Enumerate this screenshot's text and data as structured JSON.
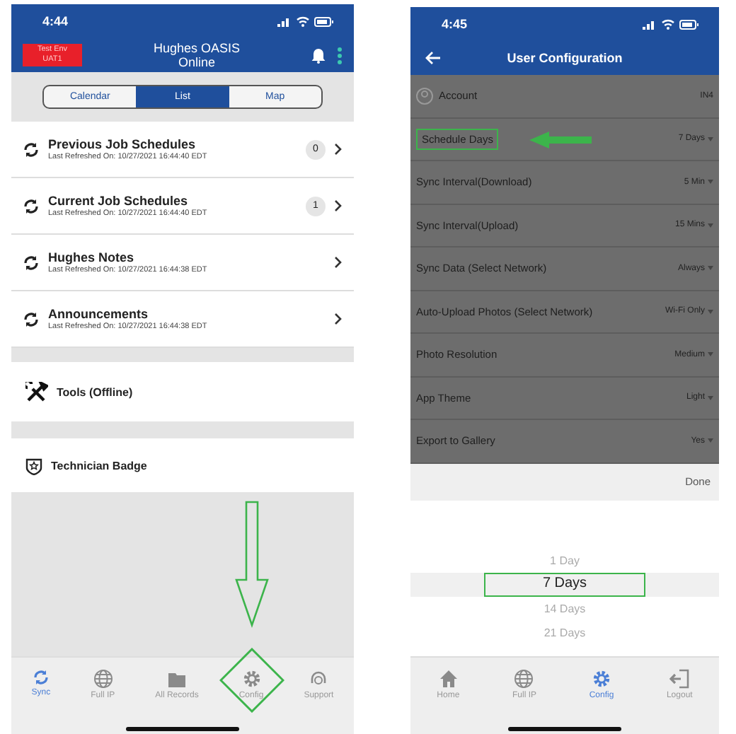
{
  "left_screen": {
    "status_bar": {
      "time": "4:44"
    },
    "header": {
      "env_badge": "Test Env UAT1",
      "title": "Hughes OASIS",
      "subtitle": "Online"
    },
    "segments": [
      {
        "label": "Calendar",
        "selected": false
      },
      {
        "label": "List",
        "selected": true
      },
      {
        "label": "Map",
        "selected": false
      }
    ],
    "sync_rows": [
      {
        "title": "Previous Job Schedules",
        "subtitle": "Last Refreshed On: 10/27/2021 16:44:40 EDT",
        "count": "0"
      },
      {
        "title": "Current Job Schedules",
        "subtitle": "Last Refreshed On: 10/27/2021 16:44:40 EDT",
        "count": "1"
      },
      {
        "title": "Hughes Notes",
        "subtitle": "Last Refreshed On: 10/27/2021 16:44:38 EDT"
      },
      {
        "title": "Announcements",
        "subtitle": "Last Refreshed On: 10/27/2021 16:44:38 EDT"
      }
    ],
    "tool_rows": [
      {
        "kind": "tools",
        "label": "Tools (Offline)"
      },
      {
        "kind": "badge",
        "label": "Technician Badge"
      }
    ],
    "callouts": [
      {
        "kind": "down-arrow"
      }
    ],
    "tab_bar": [
      {
        "kind": "sync",
        "label": "Sync",
        "selected": true,
        "highlighted": false
      },
      {
        "kind": "globe",
        "label": "Full IP",
        "selected": false,
        "highlighted": false
      },
      {
        "kind": "folder",
        "label": "All Records",
        "selected": false,
        "highlighted": false
      },
      {
        "kind": "gear",
        "label": "Config",
        "selected": false,
        "highlighted": true
      },
      {
        "kind": "support",
        "label": "Support",
        "selected": false,
        "highlighted": false
      }
    ]
  },
  "right_screen": {
    "status_bar": {
      "time": "4:45"
    },
    "header": {
      "title": "User Configuration"
    },
    "settings": [
      {
        "kind": "account",
        "label": "Account",
        "value": "IN4",
        "highlighted": false
      },
      {
        "kind": "dropdown",
        "label": "Schedule Days",
        "value": "7 Days",
        "highlighted": true
      },
      {
        "kind": "dropdown",
        "label": "Sync Interval(Download)",
        "value": "5 Min",
        "highlighted": false
      },
      {
        "kind": "dropdown",
        "label": "Sync Interval(Upload)",
        "value": "15 Mins",
        "highlighted": false
      },
      {
        "kind": "dropdown",
        "label": "Sync Data (Select Network)",
        "value": "Always",
        "highlighted": false
      },
      {
        "kind": "dropdown",
        "label": "Auto-Upload Photos (Select Network)",
        "value": "Wi-Fi Only",
        "highlighted": false
      },
      {
        "kind": "dropdown",
        "label": "Photo Resolution",
        "value": "Medium",
        "highlighted": false
      },
      {
        "kind": "dropdown",
        "label": "App Theme",
        "value": "Light",
        "highlighted": false
      },
      {
        "kind": "dropdown",
        "label": "Export to Gallery",
        "value": "Yes",
        "highlighted": false
      }
    ],
    "callouts": [
      {
        "kind": "left-arrow"
      }
    ],
    "picker": {
      "done_label": "Done",
      "options": [
        {
          "label": "1 Day",
          "selected": false,
          "highlighted": false
        },
        {
          "label": "7 Days",
          "selected": true,
          "highlighted": true
        },
        {
          "label": "14 Days",
          "selected": false,
          "highlighted": false
        },
        {
          "label": "21 Days",
          "selected": false,
          "highlighted": false
        }
      ]
    },
    "tab_bar": [
      {
        "kind": "home",
        "label": "Home",
        "selected": false,
        "highlighted": false
      },
      {
        "kind": "globe",
        "label": "Full IP",
        "selected": false,
        "highlighted": false
      },
      {
        "kind": "gear",
        "label": "Config",
        "selected": true,
        "highlighted": false
      },
      {
        "kind": "logout",
        "label": "Logout",
        "selected": false,
        "highlighted": false
      }
    ]
  }
}
